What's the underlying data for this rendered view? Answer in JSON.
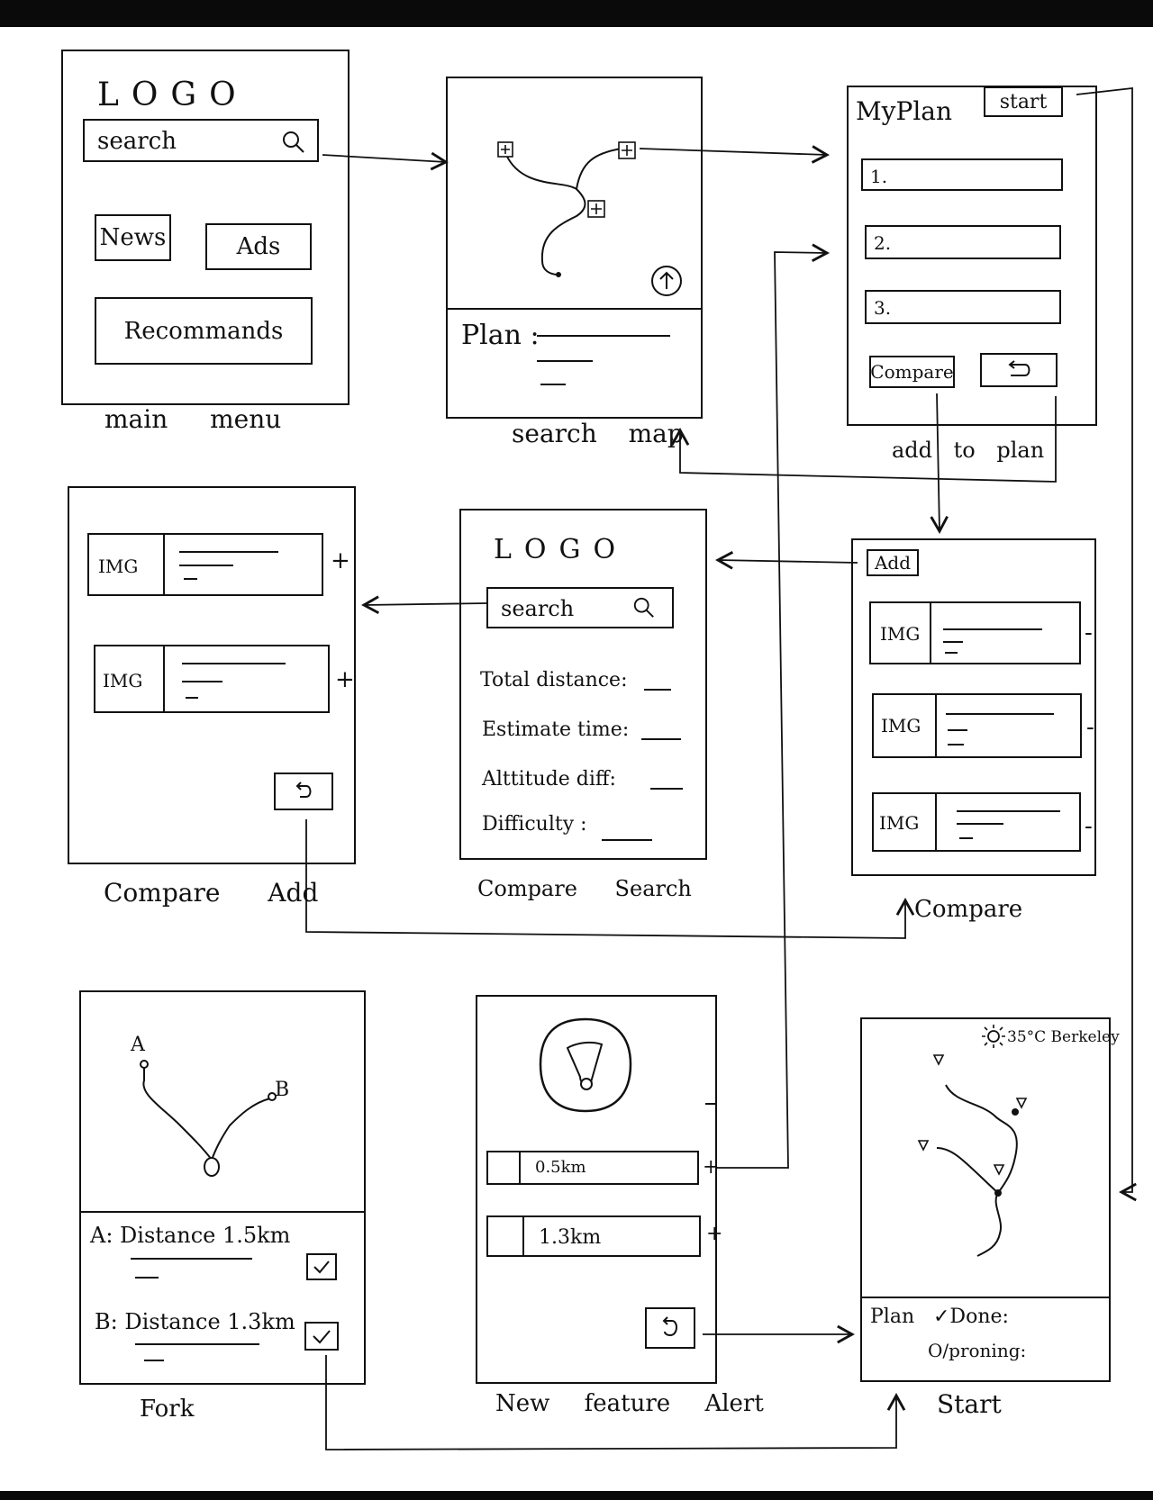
{
  "main_menu": {
    "logo": "LOGO",
    "search_placeholder": "search",
    "news": "News",
    "ads": "Ads",
    "recommands": "Recommands",
    "caption": "main menu"
  },
  "search_map": {
    "plan_label": "Plan :",
    "caption": "search map"
  },
  "add_to_plan": {
    "title": "MyPlan",
    "start": "start",
    "items": [
      "1.",
      "2.",
      "3."
    ],
    "compare": "Compare",
    "caption": "add to plan"
  },
  "compare_add": {
    "rows": [
      {
        "img": "IMG",
        "action": "+"
      },
      {
        "img": "IMG",
        "action": "+"
      }
    ],
    "caption": "Compare Add"
  },
  "compare_search": {
    "logo": "LOGO",
    "search_placeholder": "search",
    "fields": [
      "Total distance:",
      "Estimate time:",
      "Alttitude diff:",
      "Difficulty :"
    ],
    "caption": "Compare Search"
  },
  "compare": {
    "add": "Add",
    "rows": [
      {
        "img": "IMG",
        "action": "-"
      },
      {
        "img": "IMG",
        "action": "-"
      },
      {
        "img": "IMG",
        "action": "-"
      }
    ],
    "caption": "Compare"
  },
  "fork": {
    "point_a": "A",
    "point_b": "B",
    "line_a": "A: Distance 1.5km",
    "line_b": "B: Distance 1.3km",
    "caption": "Fork"
  },
  "new_feature_alert": {
    "distances": [
      {
        "value": "0.5km",
        "action": "+"
      },
      {
        "value": "1.3km",
        "action": "+"
      }
    ],
    "caption": "New feature Alert"
  },
  "start_screen": {
    "weather": "35°C Berkeley",
    "plan": "Plan",
    "done": "✓Done:",
    "ongoing": "O/proning:",
    "caption": "Start"
  },
  "icons": [
    "search-icon",
    "zoom-plus-icon",
    "upload-arrow-icon",
    "back-arrow-icon",
    "sun-icon",
    "checkbox-icon",
    "map-pin-icon",
    "compass-icon"
  ]
}
